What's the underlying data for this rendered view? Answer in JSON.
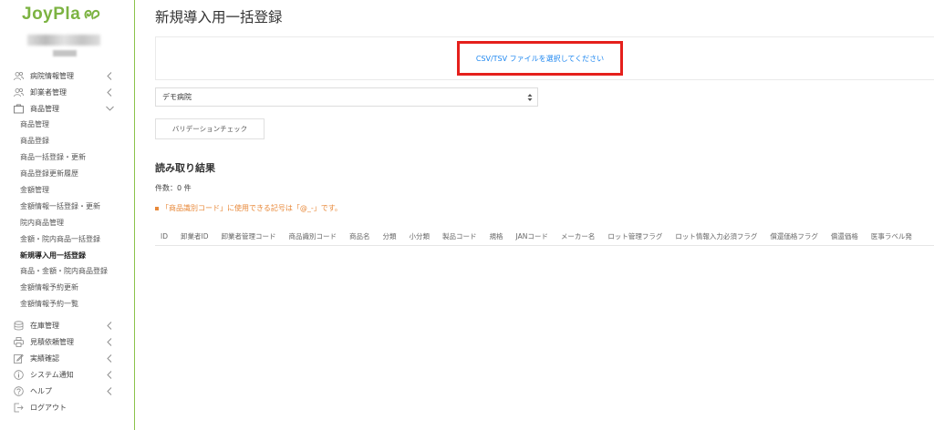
{
  "app": {
    "logo_text": "JoyPla"
  },
  "sidebar": {
    "groups": [
      {
        "label": "病院情報管理",
        "icon": "user-group-icon"
      },
      {
        "label": "卸業者管理",
        "icon": "user-group-icon"
      },
      {
        "label": "商品管理",
        "icon": "folder-icon"
      }
    ],
    "sub_items": [
      {
        "label": "商品管理"
      },
      {
        "label": "商品登録"
      },
      {
        "label": "商品一括登録・更新"
      },
      {
        "label": "商品登録更新履歴"
      },
      {
        "label": "金額管理"
      },
      {
        "label": "金額情報一括登録・更新"
      },
      {
        "label": "院内商品管理"
      },
      {
        "label": "金額・院内商品一括登録"
      },
      {
        "label": "新規導入用一括登録"
      },
      {
        "label": "商品・金額・院内商品登録"
      },
      {
        "label": "金額情報予約更新"
      },
      {
        "label": "金額情報予約一覧"
      }
    ],
    "bottom_groups": [
      {
        "label": "在庫管理",
        "icon": "database-icon"
      },
      {
        "label": "見積依頼管理",
        "icon": "printer-icon"
      },
      {
        "label": "実績確認",
        "icon": "pencil-icon"
      },
      {
        "label": "システム通知",
        "icon": "info-icon"
      },
      {
        "label": "ヘルプ",
        "icon": "question-icon"
      },
      {
        "label": "ログアウト",
        "icon": "sign-out-icon"
      }
    ]
  },
  "main": {
    "title": "新規導入用一括登録",
    "file_select": "CSV/TSV ファイルを選択してください",
    "hospital_select": "デモ病院",
    "validation_button": "バリデーションチェック",
    "result_title": "読み取り結果",
    "count_text": "件数：0 件",
    "warning_text": "「商品識別コード」に使用できる記号は「@_-」です。",
    "table_headers": [
      "ID",
      "卸業者ID",
      "卸業者管理コード",
      "商品識別コード",
      "商品名",
      "分類",
      "小分類",
      "製品コード",
      "規格",
      "JANコード",
      "メーカー名",
      "ロット管理フラグ",
      "ロット情報入力必須フラグ",
      "償還価格フラグ",
      "償還価格",
      "医事ラベル発"
    ]
  },
  "colors": {
    "brand": "#7cb342",
    "link": "#1e87f0",
    "highlight": "#e5201c",
    "warning": "#e8893a"
  }
}
